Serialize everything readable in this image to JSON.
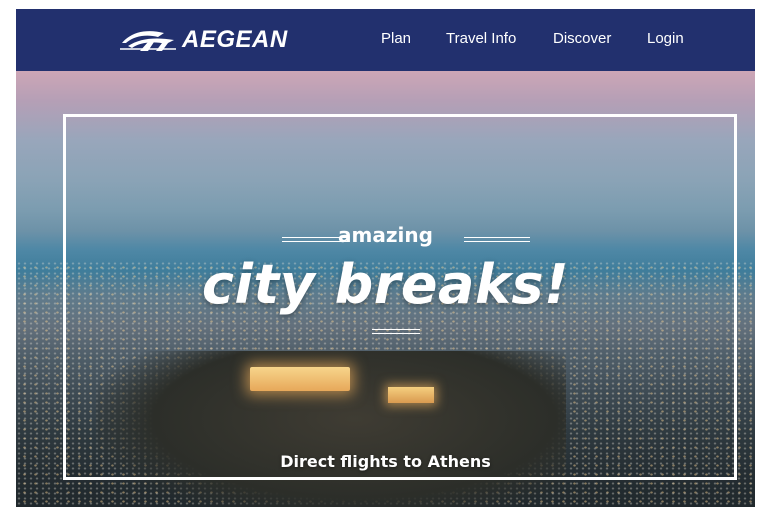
{
  "header": {
    "brand_name": "AEGEAN",
    "brand_color": "#22306e",
    "logo_icon": "aegean-bird-logo-icon",
    "nav_links": [
      {
        "label": "Plan"
      },
      {
        "label": "Travel Info"
      },
      {
        "label": "Discover"
      },
      {
        "label": "Login"
      }
    ]
  },
  "hero": {
    "kicker": "amazing",
    "headline": "city breaks!",
    "caption": "Direct flights to Athens",
    "background": "athens-acropolis-dusk-photo"
  }
}
